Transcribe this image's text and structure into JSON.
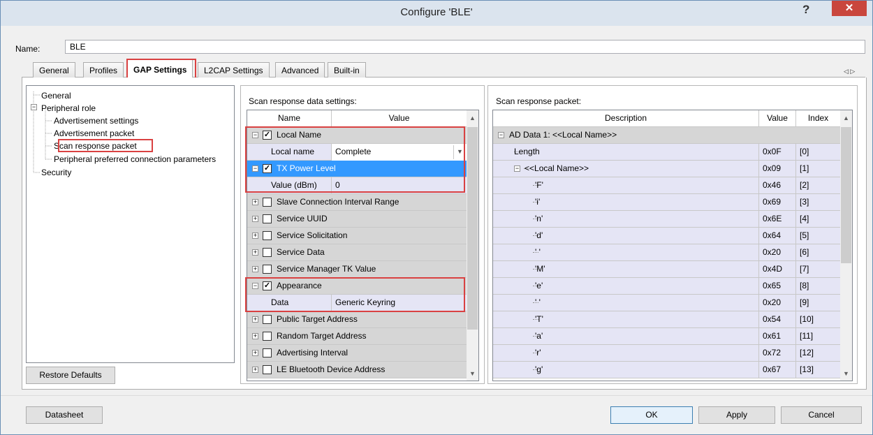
{
  "window": {
    "title": "Configure 'BLE'",
    "help_label": "?",
    "close_label": "✕"
  },
  "name": {
    "label": "Name:",
    "value": "BLE"
  },
  "tabs": [
    "General",
    "Profiles",
    "GAP Settings",
    "L2CAP Settings",
    "Advanced",
    "Built-in"
  ],
  "active_tab": "GAP Settings",
  "tab_arrows": "◁ ▷",
  "tree": {
    "general": "General",
    "peripheral": "Peripheral role",
    "adv_settings": "Advertisement settings",
    "adv_packet": "Advertisement packet",
    "scan_packet": "Scan response packet",
    "conn_params": "Peripheral preferred connection parameters",
    "security": "Security"
  },
  "restore_label": "Restore Defaults",
  "scan_settings": {
    "label": "Scan response data settings:",
    "col_name": "Name",
    "col_value": "Value",
    "rows": [
      {
        "name": "Local Name"
      },
      {
        "name": "Local name",
        "value": "Complete"
      },
      {
        "name": "TX Power Level"
      },
      {
        "name": "Value (dBm)",
        "value": "0"
      },
      {
        "name": "Slave Connection Interval Range"
      },
      {
        "name": "Service UUID"
      },
      {
        "name": "Service Solicitation"
      },
      {
        "name": "Service Data"
      },
      {
        "name": "Service Manager TK Value"
      },
      {
        "name": "Appearance"
      },
      {
        "name": "Data",
        "value": "Generic Keyring"
      },
      {
        "name": "Public Target Address"
      },
      {
        "name": "Random Target Address"
      },
      {
        "name": "Advertising Interval"
      },
      {
        "name": "LE Bluetooth Device Address"
      }
    ]
  },
  "packet": {
    "label": "Scan response packet:",
    "col_desc": "Description",
    "col_value": "Value",
    "col_index": "Index",
    "header": "AD Data 1: <<Local Name>>",
    "rows": [
      {
        "desc": "Length",
        "value": "0x0F",
        "index": "[0]"
      },
      {
        "desc": "<<Local Name>>",
        "value": "0x09",
        "index": "[1]"
      },
      {
        "desc": "'F'",
        "value": "0x46",
        "index": "[2]"
      },
      {
        "desc": "'i'",
        "value": "0x69",
        "index": "[3]"
      },
      {
        "desc": "'n'",
        "value": "0x6E",
        "index": "[4]"
      },
      {
        "desc": "'d'",
        "value": "0x64",
        "index": "[5]"
      },
      {
        "desc": "' '",
        "value": "0x20",
        "index": "[6]"
      },
      {
        "desc": "'M'",
        "value": "0x4D",
        "index": "[7]"
      },
      {
        "desc": "'e'",
        "value": "0x65",
        "index": "[8]"
      },
      {
        "desc": "' '",
        "value": "0x20",
        "index": "[9]"
      },
      {
        "desc": "'T'",
        "value": "0x54",
        "index": "[10]"
      },
      {
        "desc": "'a'",
        "value": "0x61",
        "index": "[11]"
      },
      {
        "desc": "'r'",
        "value": "0x72",
        "index": "[12]"
      },
      {
        "desc": "'g'",
        "value": "0x67",
        "index": "[13]"
      }
    ]
  },
  "buttons": {
    "datasheet": "Datasheet",
    "ok": "OK",
    "apply": "Apply",
    "cancel": "Cancel"
  },
  "colors": {
    "highlight": "#d94141",
    "selection": "#3399ff",
    "group_row": "#d6d6d6",
    "sub_row": "#e5e5f5"
  }
}
